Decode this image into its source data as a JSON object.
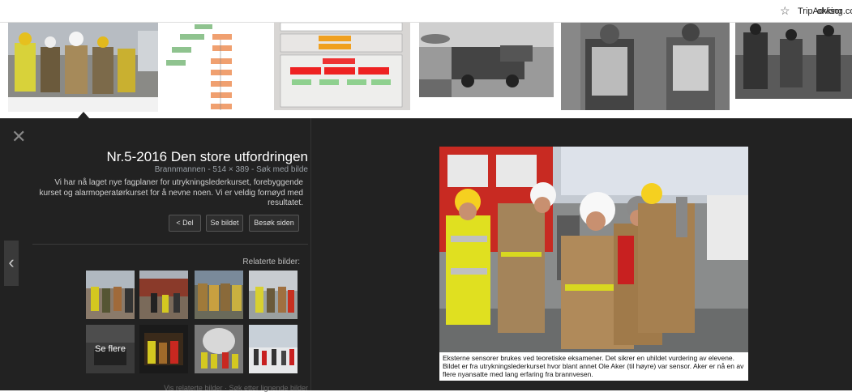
{
  "bookmarks": {
    "item1": "okking.com",
    "item2": "TripAdvisor"
  },
  "preview": {
    "title": "Nr.5-2016 Den store utfordringen",
    "meta": "Brannmannen - 514 × 389 - Søk med bilde",
    "description": "Vi har nå laget nye fagplaner for utrykningslederkurset, forebyggende kurset og alarmoperatørkurset for å nevne noen. Vi er veldig fornøyd med resultatet.",
    "buttons": {
      "visit": "Besøk siden",
      "view": "Se bildet",
      "share": "< Del"
    },
    "related_label": "Relaterte bilder:",
    "see_more": "Se flere",
    "bottom_text": "Vis relaterte bilder · Søk etter lignende bilder",
    "caption": "Eksterne sensorer brukes ved teoretiske eksamener. Det sikrer en uhildet vurdering av elevene. Bildet er fra utrykningslederkurset hvor blant annet Ole Aker (til høyre) var sensor. Aker er nå en av flere nyansatte med lang erfaring fra brannvesen."
  },
  "colors": {
    "panel_bg": "#222222",
    "bookmark_bar_bg": "#ffffff"
  },
  "icons": {
    "star": "star-icon",
    "close": "close-icon",
    "prev": "chevron-left-icon"
  }
}
